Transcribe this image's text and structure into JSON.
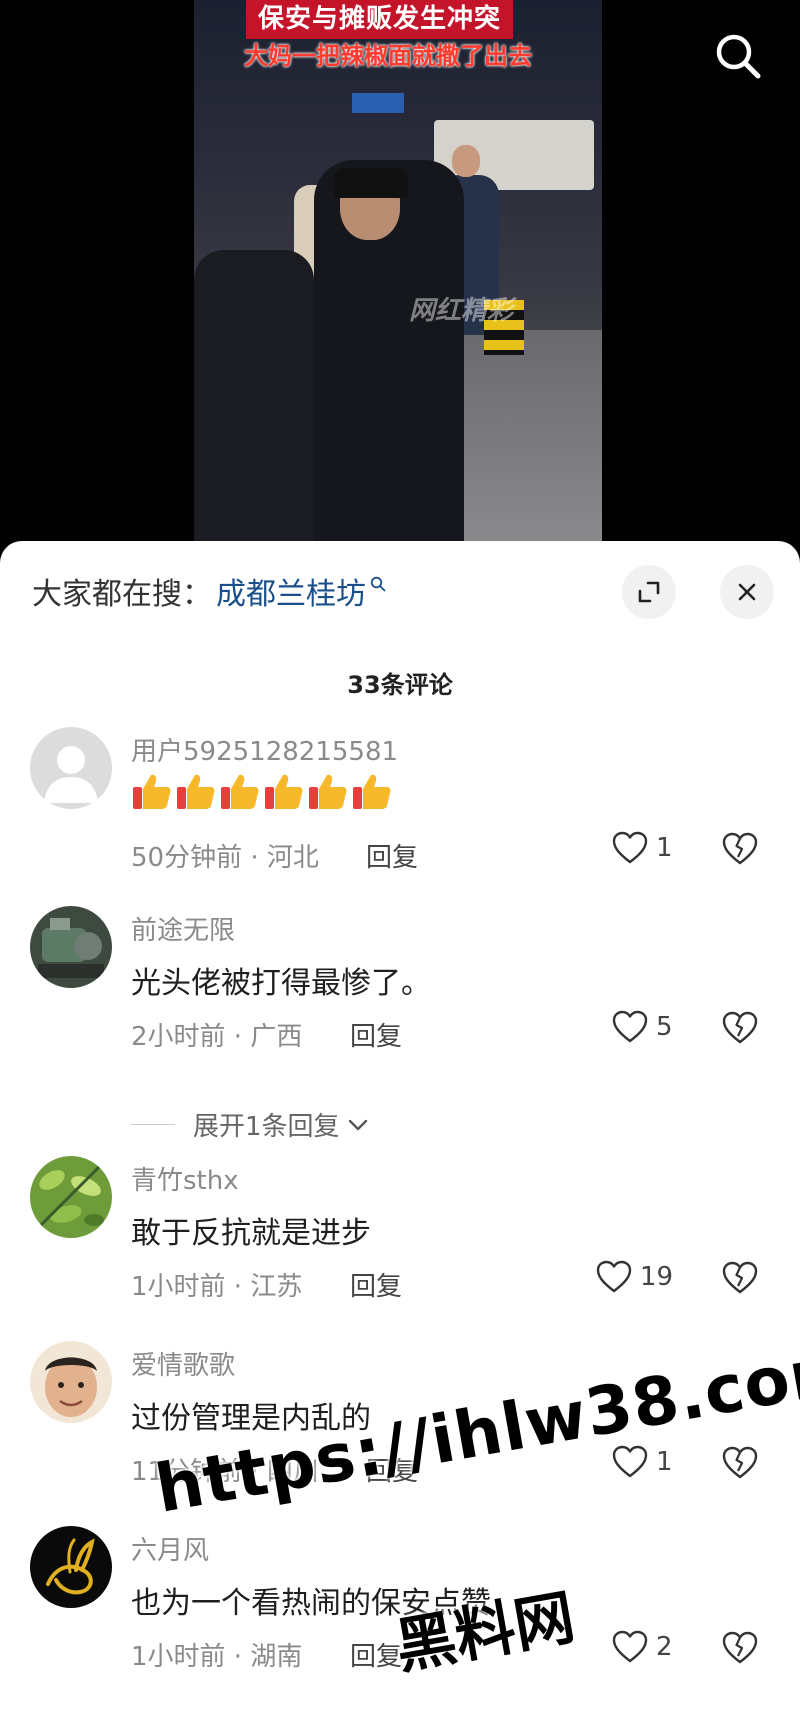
{
  "video": {
    "headline": "保安与摊贩发生冲突",
    "subheadline": "大妈一把辣椒面就撒了出去",
    "watermark": "网红精彩"
  },
  "top_bar": {
    "search_icon": "search-icon"
  },
  "sheet": {
    "search_prefix": "大家都在搜：",
    "search_term": "成都兰桂坊",
    "expand_icon": "expand-icon",
    "close_icon": "close-icon",
    "comment_count_title": "33条评论"
  },
  "comments": [
    {
      "username": "用户5925128215581",
      "text": "",
      "emoji": "thumbs-up",
      "emoji_count": 6,
      "time_location": "50分钟前 · 河北",
      "reply_label": "回复",
      "likes": "1"
    },
    {
      "username": "前途无限",
      "text": "光头佬被打得最惨了。",
      "time_location": "2小时前 · 广西",
      "reply_label": "回复",
      "likes": "5",
      "expand_replies": "展开1条回复"
    },
    {
      "username": "青竹sthx",
      "text": "敢于反抗就是进步",
      "time_location": "1小时前 · 江苏",
      "reply_label": "回复",
      "likes": "19"
    },
    {
      "username": "爱情歌歌",
      "text": "过份管理是内乱的",
      "time_location": "11分钟前 · 四川",
      "reply_label": "回复",
      "likes": "1"
    },
    {
      "username": "六月风",
      "text": "也为一个看热闹的保安点赞",
      "time_location": "1小时前 · 湖南",
      "reply_label": "回复",
      "likes": "2"
    }
  ],
  "overlay_watermark": {
    "url": "https://ihlw38.com",
    "site_name": "黑料网"
  },
  "colors": {
    "accent_link": "#1a4f8c",
    "headline_bg": "#c4142a"
  }
}
